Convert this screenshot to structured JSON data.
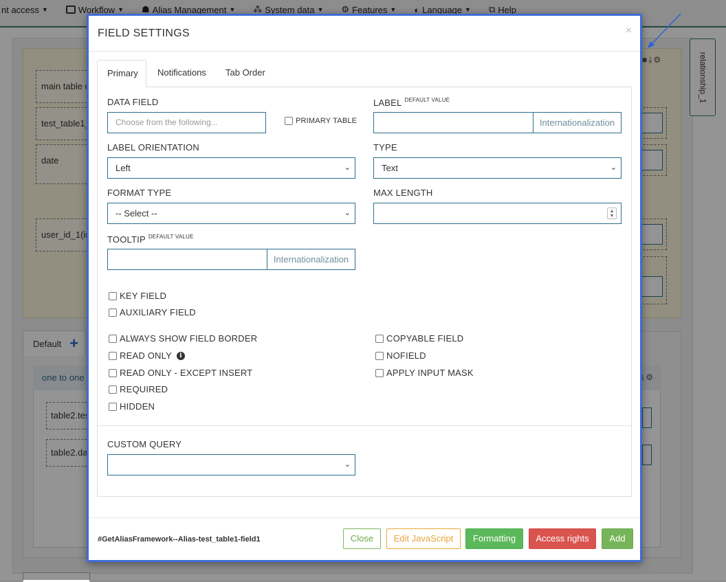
{
  "topnav": {
    "items": [
      {
        "label": "nt access",
        "icon": "none"
      },
      {
        "label": "Workflow",
        "icon": "workflow-icon"
      },
      {
        "label": "Alias Management",
        "icon": "alias-icon"
      },
      {
        "label": "System data",
        "icon": "network-icon"
      },
      {
        "label": "Features",
        "icon": "gears-icon"
      },
      {
        "label": "Language",
        "icon": "language-icon"
      },
      {
        "label": "Help",
        "icon": "help-icon"
      }
    ]
  },
  "background": {
    "fields": [
      "main table d",
      "test_table1_",
      "date",
      "user_id_1(in"
    ],
    "side_tab": "relationship_1",
    "default_tab": "Default",
    "panel_title": "one to one",
    "panel_fields": [
      "table2.tes",
      "table2.dat"
    ]
  },
  "modal": {
    "title": "FIELD SETTINGS",
    "close": "×",
    "tabs": [
      "Primary",
      "Notifications",
      "Tab Order"
    ],
    "data_field": {
      "label": "DATA FIELD",
      "placeholder": "Choose from the following..."
    },
    "primary_table": "PRIMARY TABLE",
    "label_field": {
      "label": "LABEL",
      "sup": "DEFAULT VALUE",
      "addon": "Internationalization",
      "value": ""
    },
    "label_orientation": {
      "label": "LABEL ORIENTATION",
      "value": "Left"
    },
    "type": {
      "label": "TYPE",
      "value": "Text"
    },
    "format_type": {
      "label": "FORMAT TYPE",
      "value": "-- Select --"
    },
    "max_length": {
      "label": "MAX LENGTH",
      "value": ""
    },
    "tooltip": {
      "label": "TOOLTIP",
      "sup": "DEFAULT VALUE",
      "addon": "Internationalization",
      "value": ""
    },
    "checks_left_top": [
      "KEY FIELD",
      "AUXILIARY FIELD"
    ],
    "checks_left": [
      "ALWAYS SHOW FIELD BORDER",
      "READ ONLY",
      "READ ONLY - EXCEPT INSERT",
      "REQUIRED",
      "HIDDEN"
    ],
    "checks_right": [
      "COPYABLE FIELD",
      "NOFIELD",
      "APPLY INPUT MASK"
    ],
    "custom_query": {
      "label": "CUSTOM QUERY",
      "value": ""
    },
    "footer_id": "#GetAliasFramework--Alias-test_table1-field1",
    "buttons": {
      "close": "Close",
      "edit_js": "Edit JavaScript",
      "formatting": "Formatting",
      "access_rights": "Access rights",
      "add": "Add"
    }
  },
  "colors": {
    "modal_border": "#3d6bd8",
    "input_border": "#2c6f8d",
    "success": "#5cb85c",
    "danger": "#d9534f",
    "warning": "#eaa93a"
  }
}
